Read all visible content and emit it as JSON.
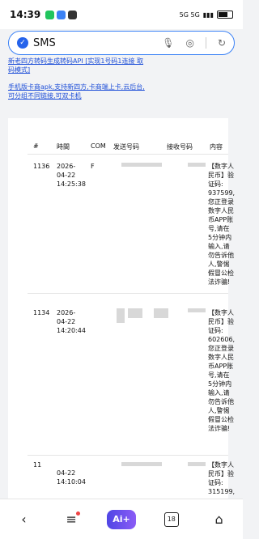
{
  "status_bar": {
    "time": "14:39",
    "signal_text": "5G 5G"
  },
  "search": {
    "query": "SMS"
  },
  "links": [
    "新老四方转码生成转码API [实现1号码1连接 取码模式]",
    "手机版卡商apk,支持新四方,卡商端上卡,云后台,可分组不同链接,可双卡机"
  ],
  "table": {
    "headers": [
      "#",
      "時間",
      "COM",
      "发送号码",
      "接收号码",
      "内容"
    ],
    "rows": [
      {
        "id": "1136",
        "time": [
          "2026-",
          "04-22",
          "14:25:38"
        ],
        "com": "F",
        "content": [
          "【数字人",
          "民币】验",
          "证码:",
          "937599,",
          "您正登录",
          "数字人民",
          "币APP账",
          "号,请在",
          "5分钟内",
          "输入,请",
          "勿告诉他",
          "人,警惕",
          "假冒公检",
          "法诈骗!"
        ]
      },
      {
        "id": "1134",
        "time": [
          "2026-",
          "04-22",
          "14:20:44"
        ],
        "com": "",
        "content": [
          "【数字人",
          "民币】验",
          "证码:",
          "602606,",
          "您正登录",
          "数字人民",
          "币APP账",
          "号,请在",
          "5分钟内",
          "输入,请",
          "勿告诉他",
          "人,警惕",
          "假冒公检",
          "法诈骗!"
        ]
      },
      {
        "id": "11",
        "time": [
          "2026-",
          "04-22",
          "14:10:04"
        ],
        "com": "",
        "content": [
          "【数字人",
          "民币】验",
          "证码:",
          "315199,"
        ]
      }
    ]
  },
  "nav": {
    "ai_label": "Ai+",
    "calendar_day": "18"
  }
}
